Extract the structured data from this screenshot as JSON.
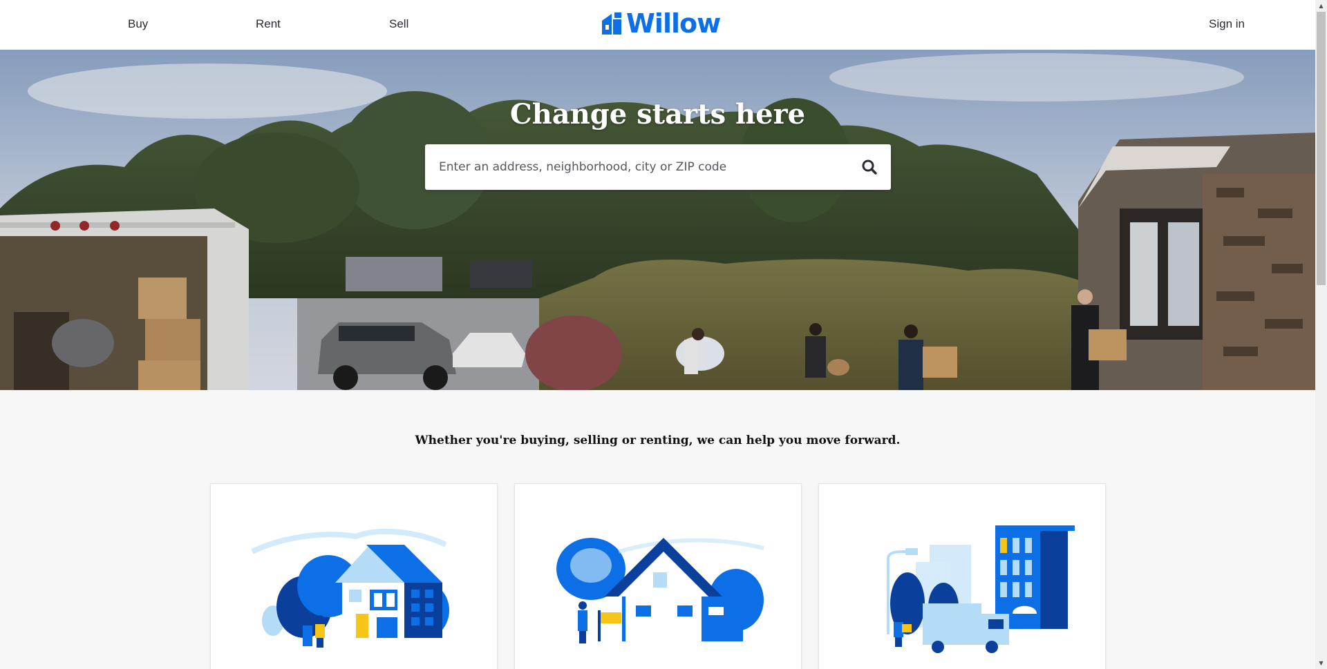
{
  "header": {
    "nav": {
      "buy": "Buy",
      "rent": "Rent",
      "sell": "Sell"
    },
    "logo_text": "Willow",
    "sign_in": "Sign in"
  },
  "hero": {
    "title": "Change starts here",
    "search_placeholder": "Enter an address, neighborhood, city or ZIP code"
  },
  "tagline": "Whether you're buying, selling or renting, we can help you move forward.",
  "cards": [
    {
      "icon": "buy-home-illustration"
    },
    {
      "icon": "sell-home-illustration"
    },
    {
      "icon": "rent-building-illustration"
    }
  ],
  "colors": {
    "brand": "#0d6fe6",
    "dark_blue": "#0a3f9c",
    "light_blue": "#b5dcf6"
  }
}
